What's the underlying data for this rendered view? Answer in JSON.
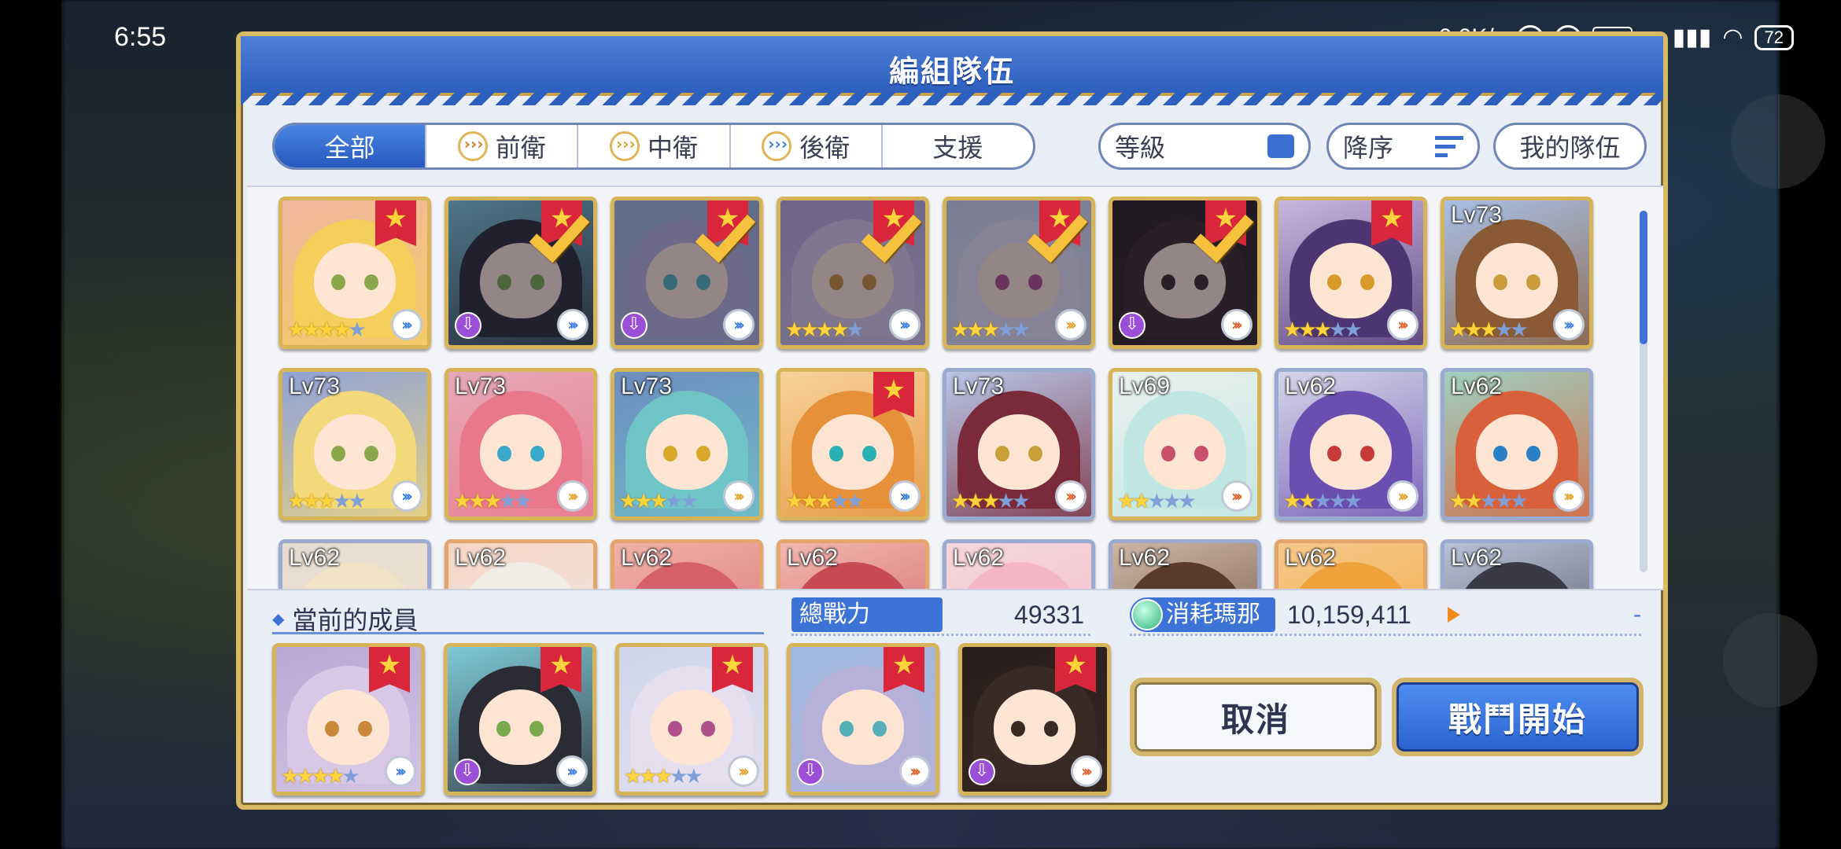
{
  "status_bar": {
    "time": "6:55",
    "network_speed": "...0.0K/s",
    "vpn": "VPN",
    "hd": "HD",
    "battery": "72"
  },
  "dialog": {
    "title": "編組隊伍"
  },
  "filters": {
    "tabs": [
      {
        "label": "全部",
        "icon": "",
        "active": true
      },
      {
        "label": "前衛",
        "icon": "front-position-icon",
        "active": false
      },
      {
        "label": "中衛",
        "icon": "mid-position-icon",
        "active": false
      },
      {
        "label": "後衛",
        "icon": "back-position-icon",
        "active": false
      },
      {
        "label": "支援",
        "icon": "",
        "active": false
      }
    ],
    "sort_by": "等級",
    "order": "降序",
    "my_team": "我的隊伍"
  },
  "roster": [
    {
      "level": "",
      "stars": 4,
      "max_stars": 5,
      "role": "back",
      "selected": false,
      "ribbon": true,
      "frame": "gold",
      "hair": "#f4cf5c",
      "eye": "#8aa84a",
      "bg": "#f2b6a0",
      "purple_badge": false
    },
    {
      "level": "",
      "stars": 0,
      "max_stars": 0,
      "role": "back",
      "selected": true,
      "ribbon": true,
      "frame": "gold",
      "hair": "#2b2b33",
      "eye": "#7aa84a",
      "bg": "#7ec9d8",
      "purple_badge": true
    },
    {
      "level": "",
      "stars": 0,
      "max_stars": 0,
      "role": "back",
      "selected": true,
      "ribbon": true,
      "frame": "gold",
      "hair": "#b7b0d8",
      "eye": "#57b0b8",
      "bg": "#9fb8e0",
      "purple_badge": true
    },
    {
      "level": "",
      "stars": 4,
      "max_stars": 5,
      "role": "back",
      "selected": true,
      "ribbon": true,
      "frame": "gold",
      "hair": "#d8c8e6",
      "eye": "#c88a3a",
      "bg": "#b9a8d6",
      "purple_badge": false
    },
    {
      "level": "",
      "stars": 3,
      "max_stars": 5,
      "role": "mid",
      "selected": true,
      "ribbon": true,
      "frame": "gold",
      "hair": "#e5dff0",
      "eye": "#b0508a",
      "bg": "#cfd6ea",
      "purple_badge": false
    },
    {
      "level": "",
      "stars": 0,
      "max_stars": 0,
      "role": "front",
      "selected": true,
      "ribbon": true,
      "frame": "gold",
      "hair": "#3a2a26",
      "eye": "#3a2a26",
      "bg": "#2a1d1d",
      "purple_badge": true
    },
    {
      "level": "",
      "stars": 3,
      "max_stars": 5,
      "role": "front",
      "selected": false,
      "ribbon": true,
      "frame": "gold",
      "hair": "#4c3570",
      "eye": "#d89a2a",
      "bg": "#c9b6e0",
      "purple_badge": false
    },
    {
      "level": "Lv73",
      "stars": 3,
      "max_stars": 5,
      "role": "back",
      "selected": false,
      "ribbon": false,
      "frame": "gold",
      "hair": "#8a5a36",
      "eye": "#c89a3a",
      "bg": "#a7c0e6",
      "purple_badge": false
    },
    {
      "level": "Lv73",
      "stars": 3,
      "max_stars": 5,
      "role": "back",
      "selected": false,
      "ribbon": false,
      "frame": "gold",
      "hair": "#f4d97a",
      "eye": "#8aa84a",
      "bg": "#8ea2d8",
      "purple_badge": false
    },
    {
      "level": "Lv73",
      "stars": 3,
      "max_stars": 5,
      "role": "mid",
      "selected": false,
      "ribbon": false,
      "frame": "gold",
      "hair": "#e9788a",
      "eye": "#3aa8c8",
      "bg": "#e6a8b8",
      "purple_badge": false
    },
    {
      "level": "Lv73",
      "stars": 3,
      "max_stars": 5,
      "role": "mid",
      "selected": false,
      "ribbon": false,
      "frame": "gold",
      "hair": "#6fc4c8",
      "eye": "#d8a82a",
      "bg": "#6e8cc0",
      "purple_badge": false
    },
    {
      "level": "",
      "stars": 3,
      "max_stars": 5,
      "role": "back",
      "selected": false,
      "ribbon": true,
      "frame": "gold",
      "hair": "#e6903a",
      "eye": "#2ab0b0",
      "bg": "#f6d29a",
      "purple_badge": false
    },
    {
      "level": "Lv73",
      "stars": 3,
      "max_stars": 5,
      "role": "front",
      "selected": false,
      "ribbon": false,
      "frame": "silver",
      "hair": "#7a2a3a",
      "eye": "#c8a03a",
      "bg": "#b8c6e6",
      "purple_badge": false
    },
    {
      "level": "Lv69",
      "stars": 2,
      "max_stars": 5,
      "role": "front",
      "selected": false,
      "ribbon": false,
      "frame": "gold",
      "hair": "#bfe6e0",
      "eye": "#c8506a",
      "bg": "#e9f0ee",
      "purple_badge": false
    },
    {
      "level": "Lv62",
      "stars": 2,
      "max_stars": 5,
      "role": "mid",
      "selected": false,
      "ribbon": false,
      "frame": "silver",
      "hair": "#6a4fb0",
      "eye": "#c83a3a",
      "bg": "#d6d6ea",
      "purple_badge": false
    },
    {
      "level": "Lv62",
      "stars": 2,
      "max_stars": 5,
      "role": "mid",
      "selected": false,
      "ribbon": false,
      "frame": "silver",
      "hair": "#d8603a",
      "eye": "#2a80c8",
      "bg": "#9fd0c0",
      "purple_badge": false
    },
    {
      "level": "Lv62",
      "stars": 0,
      "max_stars": 0,
      "role": "",
      "selected": false,
      "ribbon": false,
      "frame": "silver",
      "hair": "#f2e2c6",
      "eye": "",
      "bg": "#e6dcd2",
      "purple_badge": false
    },
    {
      "level": "Lv62",
      "stars": 0,
      "max_stars": 0,
      "role": "",
      "selected": false,
      "ribbon": false,
      "frame": "copper",
      "hair": "#f0ece6",
      "eye": "",
      "bg": "#f4d6c6",
      "purple_badge": false
    },
    {
      "level": "Lv62",
      "stars": 0,
      "max_stars": 0,
      "role": "",
      "selected": false,
      "ribbon": false,
      "frame": "copper",
      "hair": "#d6606a",
      "eye": "",
      "bg": "#f0b2a8",
      "purple_badge": false
    },
    {
      "level": "Lv62",
      "stars": 0,
      "max_stars": 0,
      "role": "",
      "selected": false,
      "ribbon": false,
      "frame": "copper",
      "hair": "#c84a52",
      "eye": "",
      "bg": "#f2b8b0",
      "purple_badge": false
    },
    {
      "level": "Lv62",
      "stars": 0,
      "max_stars": 0,
      "role": "",
      "selected": false,
      "ribbon": false,
      "frame": "silver",
      "hair": "#f4b6c6",
      "eye": "",
      "bg": "#f6d6dc",
      "purple_badge": false
    },
    {
      "level": "Lv62",
      "stars": 0,
      "max_stars": 0,
      "role": "",
      "selected": false,
      "ribbon": false,
      "frame": "silver",
      "hair": "#5a3a2a",
      "eye": "",
      "bg": "#cdb6a6",
      "purple_badge": false
    },
    {
      "level": "Lv62",
      "stars": 0,
      "max_stars": 0,
      "role": "",
      "selected": false,
      "ribbon": false,
      "frame": "copper",
      "hair": "#f0a23a",
      "eye": "",
      "bg": "#f6c88a",
      "purple_badge": false
    },
    {
      "level": "Lv62",
      "stars": 0,
      "max_stars": 0,
      "role": "",
      "selected": false,
      "ribbon": false,
      "frame": "silver",
      "hair": "#3a3a46",
      "eye": "",
      "bg": "#b8c2d8",
      "purple_badge": false
    }
  ],
  "current_members": {
    "label": "當前的成員",
    "members": [
      {
        "stars": 4,
        "max_stars": 5,
        "role": "back",
        "hair": "#d8c8e6",
        "eye": "#c88a3a",
        "bg": "#b9a8d6",
        "purple_badge": false
      },
      {
        "stars": 0,
        "max_stars": 0,
        "role": "back",
        "hair": "#2b2b33",
        "eye": "#7aa84a",
        "bg": "#7ec9d8",
        "purple_badge": true
      },
      {
        "stars": 3,
        "max_stars": 5,
        "role": "mid",
        "hair": "#e5dff0",
        "eye": "#b0508a",
        "bg": "#cfd6ea",
        "purple_badge": false
      },
      {
        "stars": 0,
        "max_stars": 0,
        "role": "front",
        "hair": "#b7b0d8",
        "eye": "#57b0b8",
        "bg": "#9fb8e0",
        "purple_badge": true
      },
      {
        "stars": 0,
        "max_stars": 0,
        "role": "front",
        "hair": "#3a2a26",
        "eye": "#3a2a26",
        "bg": "#2a1d1d",
        "purple_badge": true
      }
    ]
  },
  "stats": {
    "power_label": "總戰力",
    "power_value": "49331",
    "mana_label": "消耗瑪那",
    "mana_value": "10,159,411",
    "mana_cost": "-"
  },
  "actions": {
    "cancel": "取消",
    "start": "戰鬥開始"
  }
}
